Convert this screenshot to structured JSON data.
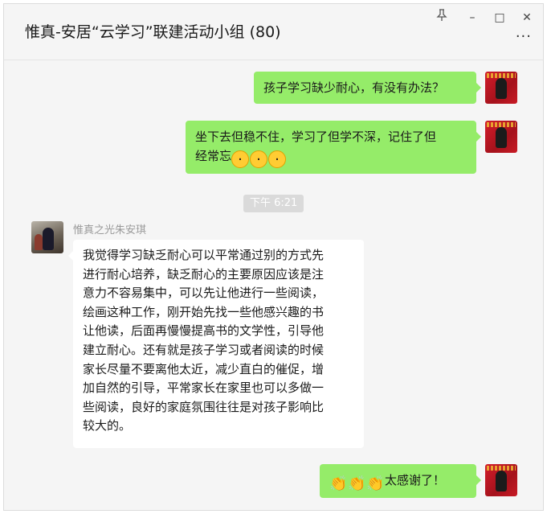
{
  "window": {
    "title": "惟真-安居“云学习”联建活动小组 (80)",
    "controls": {
      "pin_icon": "pin-icon",
      "minimize": "–",
      "maximize": "□",
      "close": "✕"
    },
    "more": "···"
  },
  "messages": [
    {
      "id": "m1",
      "from": "me",
      "text": "孩子学习缺少耐心，有没有办法？"
    },
    {
      "id": "m2",
      "from": "me",
      "text": "坐下去但稳不住，学习了但学不深，记住了但",
      "text2": "经常忘",
      "emojis": [
        "face-blowing-icon",
        "face-blowing-icon",
        "face-blowing-icon"
      ]
    },
    {
      "id": "t1",
      "type": "time",
      "text": "下午 6:21"
    },
    {
      "id": "m3",
      "from": "other",
      "sender": "惟真之光朱安琪",
      "lines": [
        "我觉得学习缺乏耐心可以平常通过别的方式先",
        "进行耐心培养，缺乏耐心的主要原因应该是注",
        "意力不容易集中，可以先让他进行一些阅读，",
        "绘画这种工作，刚开始先找一些他感兴趣的书",
        "让他读，后面再慢慢提高书的文学性，引导他",
        "建立耐心。还有就是孩子学习或者阅读的时候",
        "家长尽量不要离他太近，减少直白的催促，增",
        "加自然的引导，平常家长在家里也可以多做一",
        "些阅读，良好的家庭氛围往往是对孩子影响比",
        "较大的。"
      ]
    },
    {
      "id": "m4",
      "from": "me",
      "text": "太感谢了！",
      "emojis": [
        "clapping-hands-icon",
        "clapping-hands-icon",
        "clapping-hands-icon"
      ]
    }
  ],
  "colors": {
    "green_bubble": "#95ec69",
    "white_bubble": "#ffffff",
    "background": "#f5f5f5"
  }
}
